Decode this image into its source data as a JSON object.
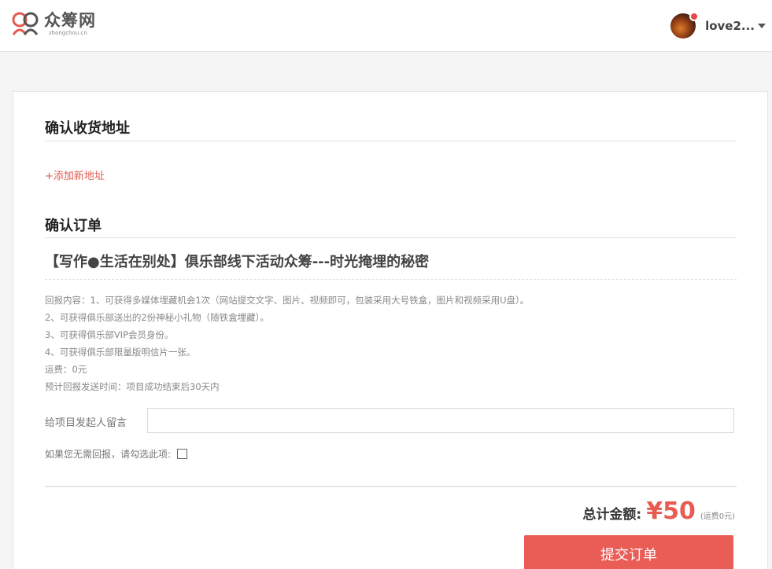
{
  "brand": {
    "name_cn": "众筹网",
    "domain": "zhongchou.cn"
  },
  "user": {
    "name": "love2..."
  },
  "colors": {
    "accent": "#e85b52",
    "link": "#e05a4f",
    "button": "#ea5c56"
  },
  "address_section": {
    "title": "确认收货地址",
    "add_link": "+添加新地址"
  },
  "order_section": {
    "title": "确认订单",
    "project_title": "【写作●生活在别处】俱乐部线下活动众筹---时光掩埋的秘密",
    "reward_lines": [
      "回报内容：1、可获得多媒体埋藏机会1次（网站提交文字、图片、视频即可，包装采用大号铁盒，图片和视频采用U盘）。",
      "2、可获得俱乐部送出的2份神秘小礼物（随铁盒埋藏）。",
      "3、可获得俱乐部VIP会员身份。",
      "4、可获得俱乐部限量版明信片一张。",
      "运费：0元",
      "预计回报发送时间：项目成功结束后30天内"
    ],
    "message_label": "给项目发起人留言",
    "message_value": "",
    "no_reward_label": "如果您无需回报，请勾选此项:",
    "no_reward_checked": false
  },
  "summary": {
    "total_label": "总计金额:",
    "total_amount": "¥50",
    "shipping_note": "(运费0元)"
  },
  "submit_label": "提交订单"
}
